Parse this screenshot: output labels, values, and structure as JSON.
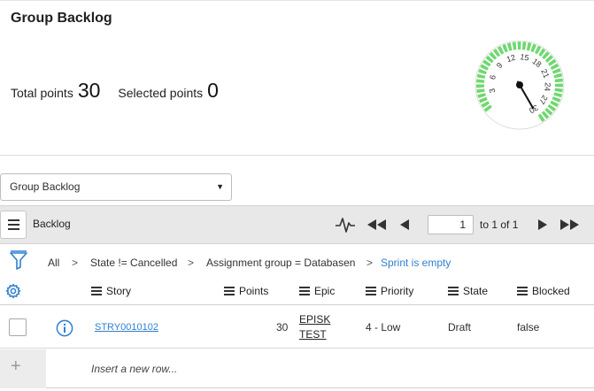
{
  "summary": {
    "title": "Group Backlog",
    "total_label": "Total points",
    "total_value": "30",
    "selected_label": "Selected points",
    "selected_value": "0"
  },
  "gauge": {
    "ticks": [
      "3",
      "6",
      "9",
      "12",
      "15",
      "18",
      "21",
      "24",
      "27",
      "30"
    ],
    "min": 0,
    "max": 30,
    "value": 30,
    "fill_color": "#6ed86e",
    "track_color": "#c8f0c8"
  },
  "group_select": {
    "selected": "Group Backlog"
  },
  "list_bar": {
    "title": "Backlog",
    "page_value": "1",
    "page_range": "to 1 of 1"
  },
  "breadcrumb": {
    "items": [
      "All",
      "State != Cancelled",
      "Assignment group = Databasen",
      "Sprint is empty"
    ],
    "separator": ">"
  },
  "table": {
    "columns": [
      "Story",
      "Points",
      "Epic",
      "Priority",
      "State",
      "Blocked"
    ],
    "rows": [
      {
        "story": "STRY0010102",
        "points": "30",
        "epic_line1": "EPISK",
        "epic_line2": "TEST",
        "priority": "4 - Low",
        "state": "Draft",
        "blocked": "false"
      }
    ],
    "insert_placeholder": "Insert a new row..."
  },
  "colors": {
    "accent_link": "#2f7fd1",
    "bar_bg": "#e8e8e8"
  }
}
